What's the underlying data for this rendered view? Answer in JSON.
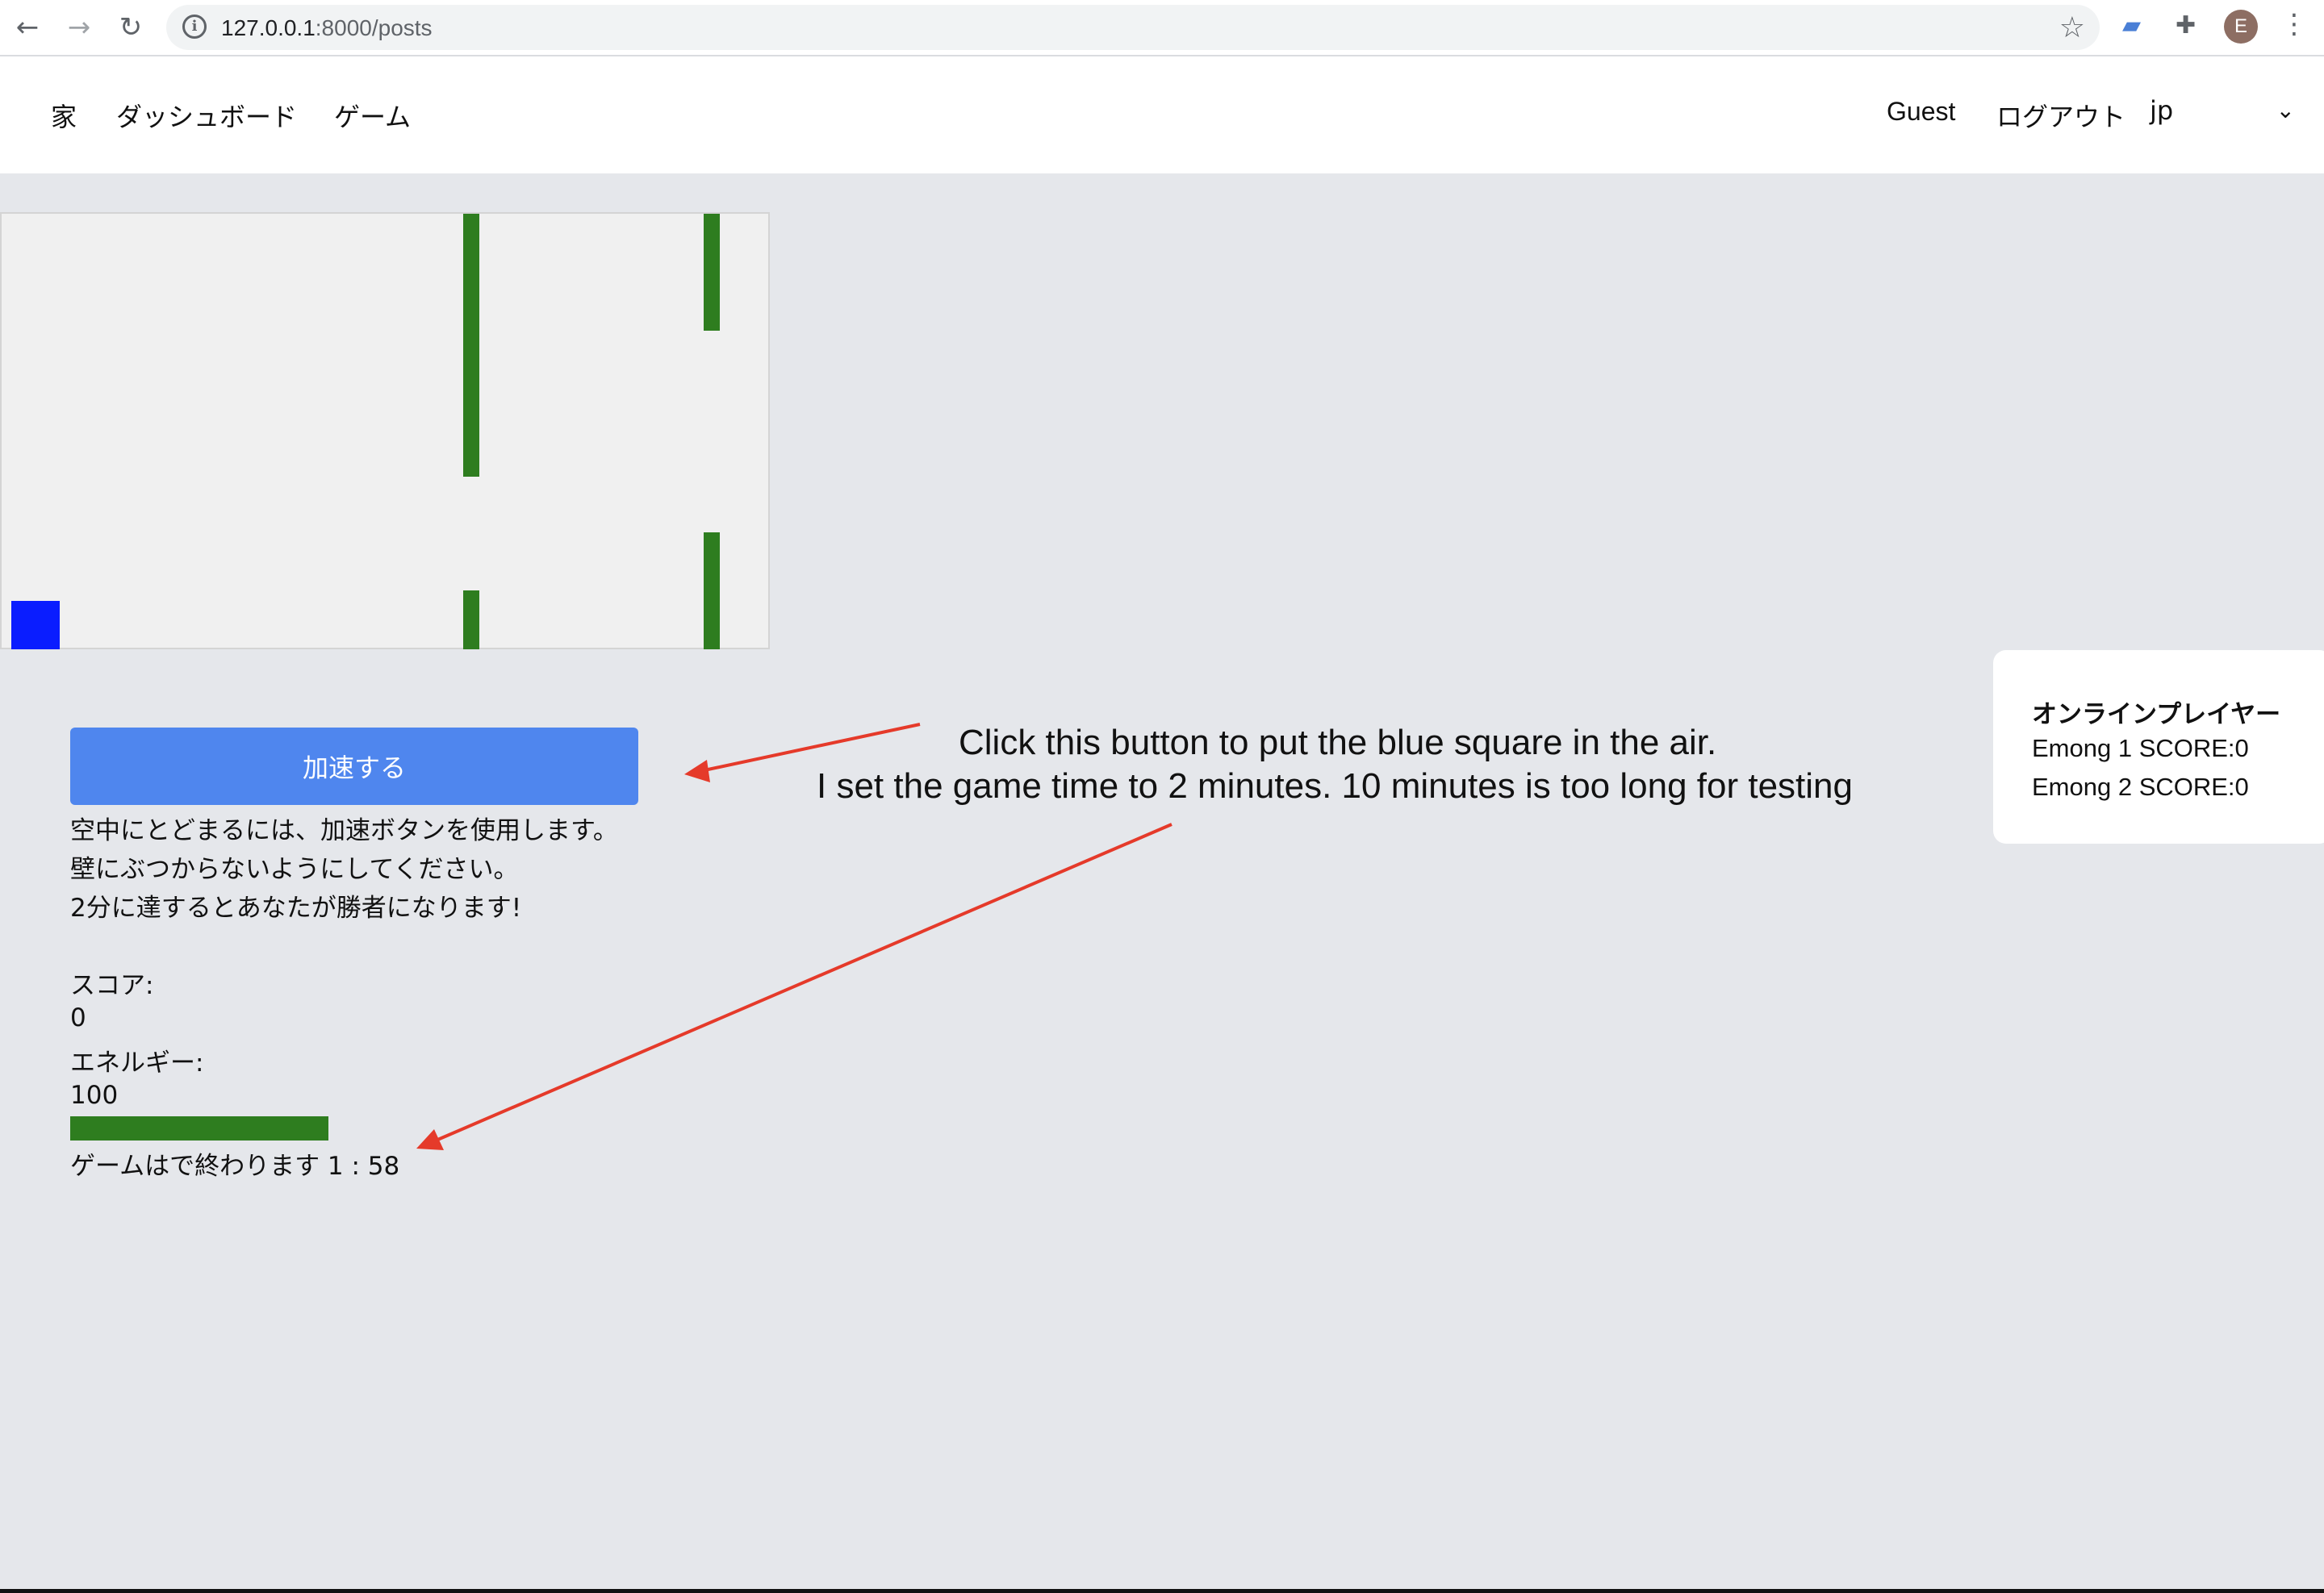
{
  "browser": {
    "url_host": "127.0.0.1",
    "url_path": ":8000/posts",
    "avatar_letter": "E",
    "icons": [
      "back-icon",
      "forward-icon",
      "reload-icon",
      "info-icon",
      "star-icon",
      "extension-icon",
      "puzzle-icon",
      "menu-icon"
    ]
  },
  "nav": {
    "home": "家",
    "dashboard": "ダッシュボード",
    "game": "ゲーム",
    "user": "Guest",
    "logout": "ログアウト",
    "language": "jp"
  },
  "game": {
    "accelerate_label": "加速する",
    "instructions": [
      "空中にとどまるには、加速ボタンを使用します。",
      "壁にぶつからないようにしてください。",
      "2分に達するとあなたが勝者になります!"
    ],
    "score_label": "スコア:",
    "score_value": "0",
    "energy_label": "エネルギー:",
    "energy_value": "100",
    "energy_fraction": 1.0,
    "timer_text": "ゲームはで終わります 1 : 58",
    "colors": {
      "pipe": "#2e7d1f",
      "player": "#0a1dff",
      "button": "#4f86ee"
    }
  },
  "players": {
    "title": "オンラインプレイヤー",
    "entries": [
      "Emong 1 SCORE:0",
      "Emong 2 SCORE:0"
    ]
  },
  "annotations": {
    "line1": "Click this button to put the blue square in the air.",
    "line2": "I set the game time to 2 minutes. 10 minutes is too long for testing",
    "arrow_color": "#e53a2a"
  }
}
